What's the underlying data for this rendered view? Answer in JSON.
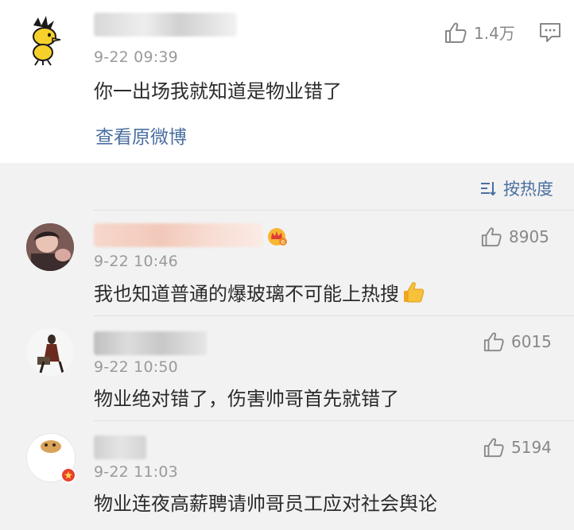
{
  "post": {
    "time": "9-22 09:39",
    "text": "你一出场我就知道是物业错了",
    "likes": "1.4万",
    "view_original": "查看原微博"
  },
  "sort": {
    "label": "按热度"
  },
  "comments": [
    {
      "time": "9-22 10:46",
      "text": "我也知道普通的爆玻璃不可能上热搜",
      "likes": "8905"
    },
    {
      "time": "9-22 10:50",
      "text": "物业绝对错了，伤害帅哥首先就错了",
      "likes": "6015"
    },
    {
      "time": "9-22 11:03",
      "text": "物业连夜高薪聘请帅哥员工应对社会舆论",
      "likes": "5194"
    }
  ],
  "colors": {
    "link": "#4a6fa0",
    "background": "#f2f2f2"
  }
}
